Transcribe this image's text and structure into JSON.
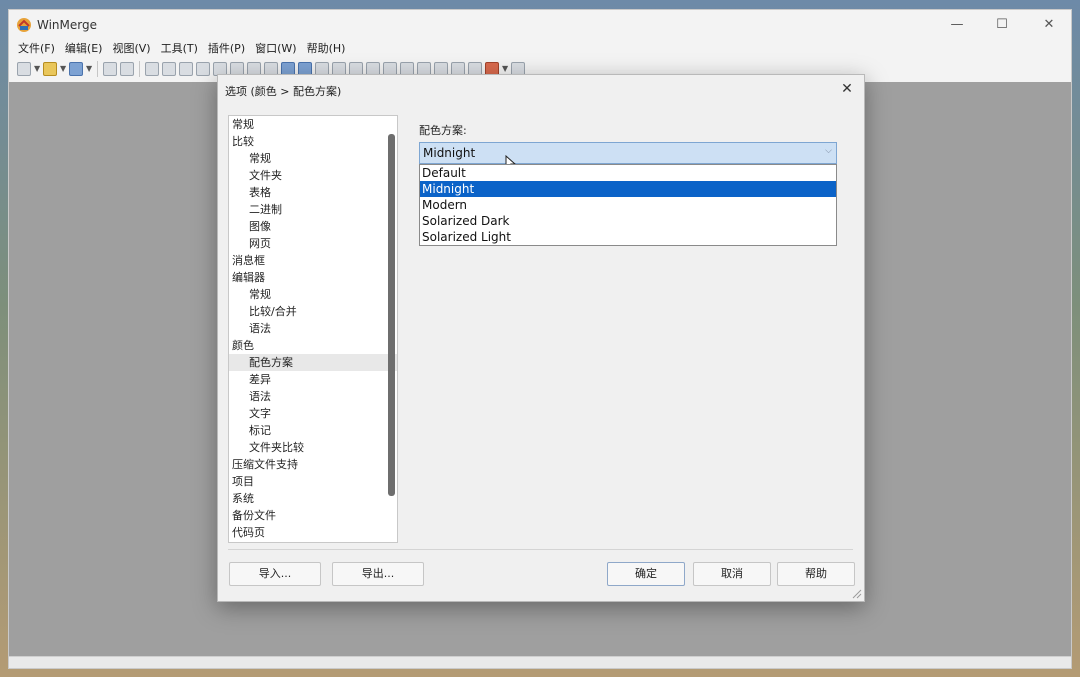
{
  "app": {
    "title": "WinMerge",
    "window_controls": {
      "minimize": "—",
      "maximize": "☐",
      "close": "✕"
    }
  },
  "menu": [
    "文件(F)",
    "编辑(E)",
    "视图(V)",
    "工具(T)",
    "插件(P)",
    "窗口(W)",
    "帮助(H)"
  ],
  "dialog": {
    "title": "选项 (颜色 > 配色方案)",
    "close": "✕",
    "tree": [
      {
        "label": "常规",
        "level": 0
      },
      {
        "label": "比较",
        "level": 0
      },
      {
        "label": "常规",
        "level": 1
      },
      {
        "label": "文件夹",
        "level": 1
      },
      {
        "label": "表格",
        "level": 1
      },
      {
        "label": "二进制",
        "level": 1
      },
      {
        "label": "图像",
        "level": 1
      },
      {
        "label": "网页",
        "level": 1
      },
      {
        "label": "消息框",
        "level": 0
      },
      {
        "label": "编辑器",
        "level": 0
      },
      {
        "label": "常规",
        "level": 1
      },
      {
        "label": "比较/合并",
        "level": 1
      },
      {
        "label": "语法",
        "level": 1
      },
      {
        "label": "颜色",
        "level": 0
      },
      {
        "label": "配色方案",
        "level": 1,
        "selected": true
      },
      {
        "label": "差异",
        "level": 1
      },
      {
        "label": "语法",
        "level": 1
      },
      {
        "label": "文字",
        "level": 1
      },
      {
        "label": "标记",
        "level": 1
      },
      {
        "label": "文件夹比较",
        "level": 1
      },
      {
        "label": "压缩文件支持",
        "level": 0
      },
      {
        "label": "项目",
        "level": 0
      },
      {
        "label": "系统",
        "level": 0
      },
      {
        "label": "备份文件",
        "level": 0
      },
      {
        "label": "代码页",
        "level": 0
      }
    ],
    "scheme_label": "配色方案:",
    "scheme_value": "Midnight",
    "scheme_options": [
      "Default",
      "Midnight",
      "Modern",
      "Solarized Dark",
      "Solarized Light"
    ],
    "scheme_selected_index": 1,
    "buttons": {
      "import": "导入...",
      "export": "导出...",
      "ok": "确定",
      "cancel": "取消",
      "help": "帮助"
    }
  },
  "colors": {
    "selection": "#0b63c8",
    "combo_focus": "#cde0f4"
  }
}
